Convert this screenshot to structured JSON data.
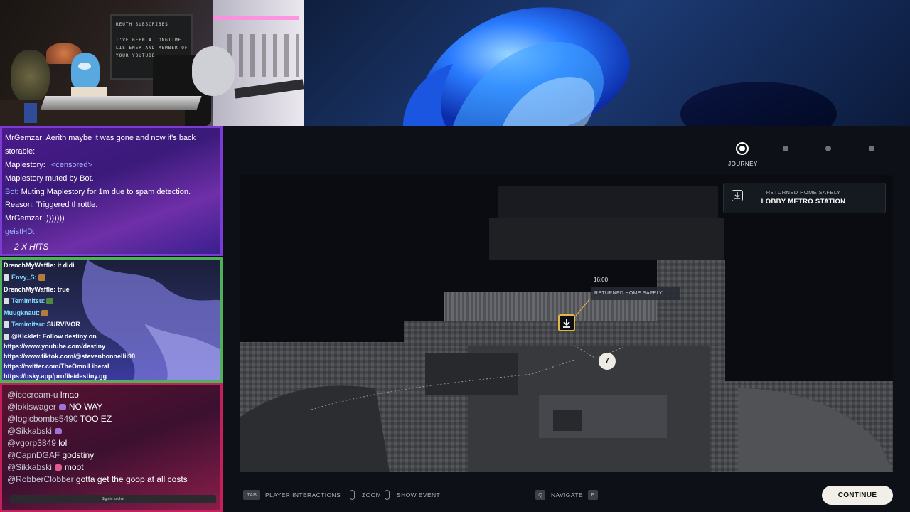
{
  "webcam": {
    "sign_text": "REUTH SUBSCRIBES\n\nI'VE BEEN A LONGTIME\nLISTENER AND MEMBER OF\nYOUR YOUTUBE"
  },
  "chat_panel_1": {
    "lines": [
      {
        "user": "MrGemzar:",
        "text": " Aerith maybe it was gone and now it's back"
      },
      {
        "user": "storable:",
        "text": ""
      },
      {
        "user": "Maplestory:",
        "text": "<censored>"
      },
      {
        "user": "Maplestory muted by Bot.",
        "text": ""
      },
      {
        "user": "Bot",
        "text": ": Muting Maplestory for 1m due to spam detection."
      },
      {
        "user": "Reason: Triggered throttle.",
        "text": ""
      },
      {
        "user": "MrGemzar:",
        "text": " )))))))"
      },
      {
        "user": "geistHD:",
        "text": ""
      },
      {
        "user": "2 X",
        "text": "HITS"
      }
    ]
  },
  "chat_panel_2": {
    "lines": [
      {
        "user": "DrenchMyWaffle:",
        "text": " it didi"
      },
      {
        "user": "Envy_S:",
        "text": ""
      },
      {
        "user": "DrenchMyWaffle:",
        "text": " true"
      },
      {
        "user": "Temimitsu:",
        "text": ""
      },
      {
        "user": "Muugknaut:",
        "text": ""
      },
      {
        "user": "Temimitsu:",
        "text": " SURVIVOR"
      },
      {
        "user": "@Kicklet:",
        "text": " Follow destiny on"
      }
    ],
    "links": [
      "https://www.youtube.com/destiny",
      "https://www.tiktok.com/@stevenbonnellii98",
      "https://twitter.com/TheOmniLiberal",
      "https://bsky.app/profile/destiny.gg"
    ]
  },
  "chat_panel_3": {
    "lines": [
      {
        "user": "@icecream-u",
        "text": " lmao"
      },
      {
        "user": "@lokiswager",
        "text": "NO WAY"
      },
      {
        "user": "@logicbombs5490",
        "text": " TOO EZ"
      },
      {
        "user": "@Sikkabski",
        "text": ""
      },
      {
        "user": "@vgorp3849",
        "text": " lol"
      },
      {
        "user": "@CapnDGAF",
        "text": " godstiny"
      },
      {
        "user": "@Sikkabski",
        "text": "moot"
      },
      {
        "user": "@RobberClobber",
        "text": " gotta get the goop at all costs"
      }
    ],
    "sign_in_label": "Sign in to chat"
  },
  "game": {
    "timeline": {
      "active_label": "JOURNEY"
    },
    "event_card": {
      "subtitle": "RETURNED HOME SAFELY",
      "title": "LOBBY METRO STATION"
    },
    "marker": {
      "time": "16:00",
      "label": "RETURNED HOME SAFELY",
      "count": "7"
    },
    "footer": {
      "tab_key": "TAB",
      "player_interactions": "PLAYER INTERACTIONS",
      "zoom": "ZOOM",
      "show_event": "SHOW EVENT",
      "q_key": "Q",
      "navigate": "NAVIGATE",
      "e_key": "E",
      "continue": "CONTINUE"
    }
  }
}
